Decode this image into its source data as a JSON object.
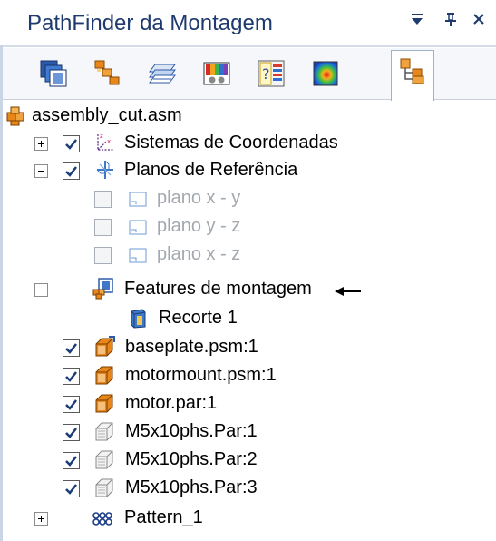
{
  "title_bar": {
    "title": "PathFinder da Montagem",
    "menu_glyph": "▾",
    "pin_glyph": "ᵖ",
    "close_glyph": "✕"
  },
  "toolbar": {
    "tabs": [
      {
        "icon": "parts-stack-icon"
      },
      {
        "icon": "assembly-structure-icon"
      },
      {
        "icon": "layers-icon"
      },
      {
        "icon": "simulation-display-icon"
      },
      {
        "icon": "reports-icon"
      },
      {
        "icon": "heat-map-icon"
      },
      {
        "icon": "assembly-tree-icon",
        "active": true
      }
    ]
  },
  "tree": {
    "root": {
      "label": "assembly_cut.asm",
      "icon": "assembly-icon"
    },
    "items": [
      {
        "label": "Sistemas de Coordenadas",
        "icon": "coordinate-system-icon",
        "expander": "plus",
        "checked": true
      },
      {
        "label": "Planos de Referência",
        "icon": "reference-planes-icon",
        "expander": "minus",
        "checked": true
      },
      {
        "label": "plano x - y",
        "icon": "plane-icon",
        "checked": false,
        "disabled": true
      },
      {
        "label": "plano y - z",
        "icon": "plane-icon",
        "checked": false,
        "disabled": true
      },
      {
        "label": "plano x - z",
        "icon": "plane-icon",
        "checked": false,
        "disabled": true
      },
      {
        "label": "Features de montagem",
        "icon": "assembly-features-icon",
        "expander": "minus",
        "arrow": "◀—"
      },
      {
        "label": "Recorte 1",
        "icon": "cut-feature-icon"
      },
      {
        "label": "baseplate.psm:1",
        "icon": "sheet-metal-part-icon",
        "checked": true
      },
      {
        "label": "motormount.psm:1",
        "icon": "part-icon",
        "checked": true
      },
      {
        "label": "motor.par:1",
        "icon": "part-icon",
        "checked": true
      },
      {
        "label": "M5x10phs.Par:1",
        "icon": "fastener-icon",
        "checked": true
      },
      {
        "label": "M5x10phs.Par:2",
        "icon": "fastener-icon",
        "checked": true
      },
      {
        "label": "M5x10phs.Par:3",
        "icon": "fastener-icon",
        "checked": true
      },
      {
        "label": "Pattern_1",
        "icon": "pattern-icon",
        "expander": "plus"
      }
    ]
  },
  "colors": {
    "title_text": "#1e3a6e",
    "disabled_text": "#a3a8ae",
    "part_orange": "#e8861a",
    "plane_blue": "#3e78c8"
  }
}
